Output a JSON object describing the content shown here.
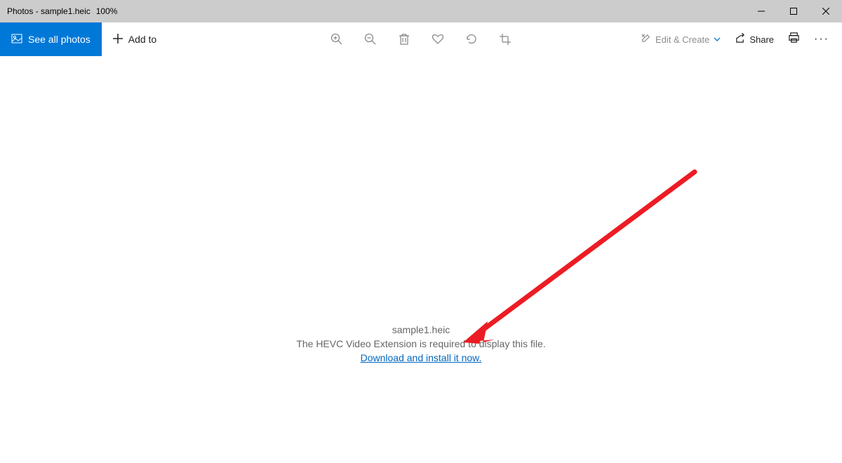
{
  "titlebar": {
    "app": "Photos",
    "file": "sample1.heic",
    "zoom": "100%"
  },
  "toolbar": {
    "see_all": "See all photos",
    "add_to": "Add to",
    "edit_create": "Edit & Create",
    "share": "Share"
  },
  "message": {
    "filename": "sample1.heic",
    "need": "The HEVC Video Extension is required to display this file.",
    "link": "Download and install it now."
  }
}
